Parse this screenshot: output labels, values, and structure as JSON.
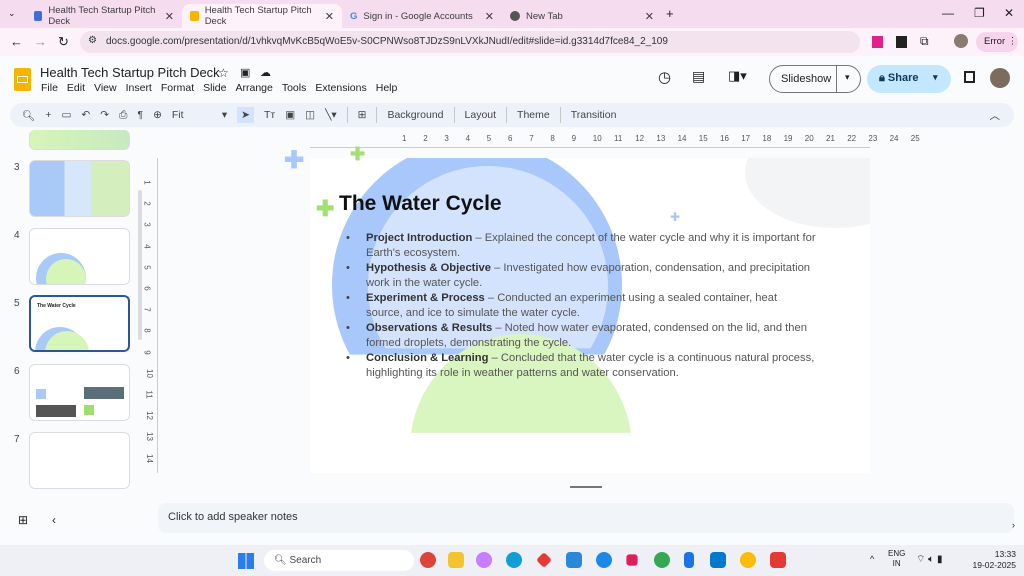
{
  "browser": {
    "tabs": [
      {
        "title": "Health Tech Startup Pitch Deck",
        "active": false
      },
      {
        "title": "Health Tech Startup Pitch Deck",
        "active": true
      },
      {
        "title": "Sign in - Google Accounts",
        "active": false
      },
      {
        "title": "New Tab",
        "active": false
      }
    ],
    "url": "docs.google.com/presentation/d/1vhkvqMvKcB5qWoE5v-S0CPNWso8TJDzS9nLVXkJNudI/edit#slide=id.g3314d7fce84_2_109",
    "profile_status": "Error"
  },
  "doc": {
    "title": "Health Tech Startup Pitch Deck",
    "menu": [
      "File",
      "Edit",
      "View",
      "Insert",
      "Format",
      "Slide",
      "Arrange",
      "Tools",
      "Extensions",
      "Help"
    ],
    "slideshow_label": "Slideshow",
    "share_label": "Share",
    "accent": "#c2e7ff"
  },
  "toolbar": {
    "zoom": "Fit",
    "background": "Background",
    "layout": "Layout",
    "theme": "Theme",
    "transition": "Transition"
  },
  "filmstrip": {
    "numbers": [
      "3",
      "4",
      "5",
      "6",
      "7"
    ],
    "selected": "5"
  },
  "ruler": {
    "h": [
      "1",
      "2",
      "3",
      "4",
      "5",
      "6",
      "7",
      "8",
      "9",
      "10",
      "11",
      "12",
      "13",
      "14",
      "15",
      "16",
      "17",
      "18",
      "19",
      "20",
      "21",
      "22",
      "23",
      "24",
      "25"
    ],
    "v": [
      "1",
      "2",
      "3",
      "4",
      "5",
      "6",
      "7",
      "8",
      "9",
      "10",
      "11",
      "12",
      "13",
      "14"
    ]
  },
  "slide": {
    "title": "The Water Cycle",
    "bullets": [
      {
        "head": "Project Introduction",
        "body": " – Explained the concept of the water cycle and why it is important for Earth's ecosystem."
      },
      {
        "head": "Hypothesis & Objective",
        "body": " – Investigated how evaporation, condensation, and precipitation work in the water cycle."
      },
      {
        "head": "Experiment & Process",
        "body": " – Conducted an experiment using a sealed container, heat source, and ice to simulate the water cycle."
      },
      {
        "head": "Observations & Results",
        "body": " – Noted how water evaporated, condensed on the lid, and then formed droplets, demonstrating the cycle."
      },
      {
        "head": "Conclusion & Learning",
        "body": " – Concluded that the water cycle is a continuous natural process, highlighting its role in weather patterns and water conservation."
      }
    ]
  },
  "notes": {
    "placeholder": "Click to add speaker notes"
  },
  "taskbar": {
    "search": "Search",
    "lang1": "ENG",
    "lang2": "IN",
    "time": "13:33",
    "date": "19-02-2025"
  }
}
